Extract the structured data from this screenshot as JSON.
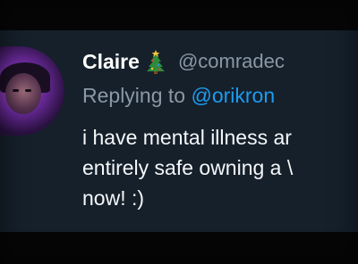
{
  "tweet": {
    "display_name": "Claire",
    "emoji_icon": "christmas-tree-icon",
    "handle": "@comradec",
    "reply_prefix": "Replying to",
    "reply_handle": "@orikron",
    "text_lines": [
      "i have mental illness ar",
      "entirely safe owning a \\",
      "now! :)"
    ]
  },
  "colors": {
    "tweet_background": "#15202b",
    "outer_background": "#060607",
    "handle_gray": "#8b98a5",
    "link_blue": "#1d9bf0",
    "text_white": "#f5f7f9"
  }
}
